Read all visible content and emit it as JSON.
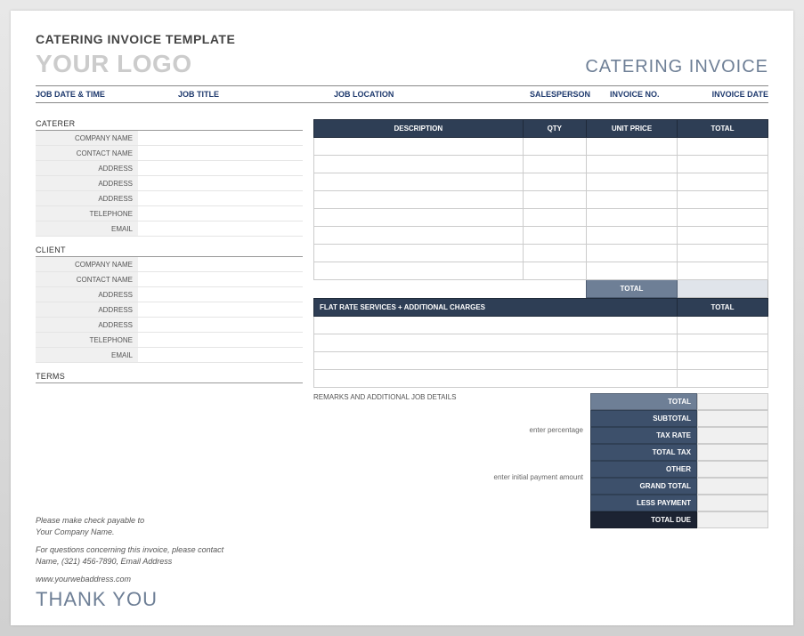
{
  "template_title": "CATERING INVOICE TEMPLATE",
  "logo_placeholder": "YOUR LOGO",
  "invoice_title": "CATERING INVOICE",
  "job_header": {
    "datetime": "JOB DATE & TIME",
    "title": "JOB TITLE",
    "location": "JOB LOCATION",
    "salesperson": "SALESPERSON",
    "invoice_no": "INVOICE NO.",
    "invoice_date": "INVOICE DATE"
  },
  "caterer": {
    "section": "CATERER",
    "labels": [
      "COMPANY NAME",
      "CONTACT NAME",
      "ADDRESS",
      "ADDRESS",
      "ADDRESS",
      "TELEPHONE",
      "EMAIL"
    ]
  },
  "client": {
    "section": "CLIENT",
    "labels": [
      "COMPANY NAME",
      "CONTACT NAME",
      "ADDRESS",
      "ADDRESS",
      "ADDRESS",
      "TELEPHONE",
      "EMAIL"
    ]
  },
  "terms_label": "TERMS",
  "items": {
    "headers": {
      "description": "DESCRIPTION",
      "qty": "QTY",
      "unit_price": "UNIT PRICE",
      "total": "TOTAL"
    },
    "total_label": "TOTAL"
  },
  "flat": {
    "header": "FLAT RATE SERVICES + ADDITIONAL CHARGES",
    "total_header": "TOTAL"
  },
  "remarks_title": "REMARKS AND ADDITIONAL JOB DETAILS",
  "hints": {
    "percentage": "enter percentage",
    "initial_payment": "enter initial payment amount"
  },
  "summary": {
    "total": "TOTAL",
    "subtotal": "SUBTOTAL",
    "tax_rate": "TAX RATE",
    "total_tax": "TOTAL TAX",
    "other": "OTHER",
    "grand_total": "GRAND TOTAL",
    "less_payment": "LESS PAYMENT",
    "total_due": "TOTAL DUE"
  },
  "footer": {
    "line1": "Please make check payable to",
    "line2": "Your Company Name.",
    "line3": "For questions concerning this invoice, please contact",
    "line4": "Name, (321) 456-7890, Email Address",
    "line5": "www.yourwebaddress.com"
  },
  "thank_you": "THANK YOU"
}
